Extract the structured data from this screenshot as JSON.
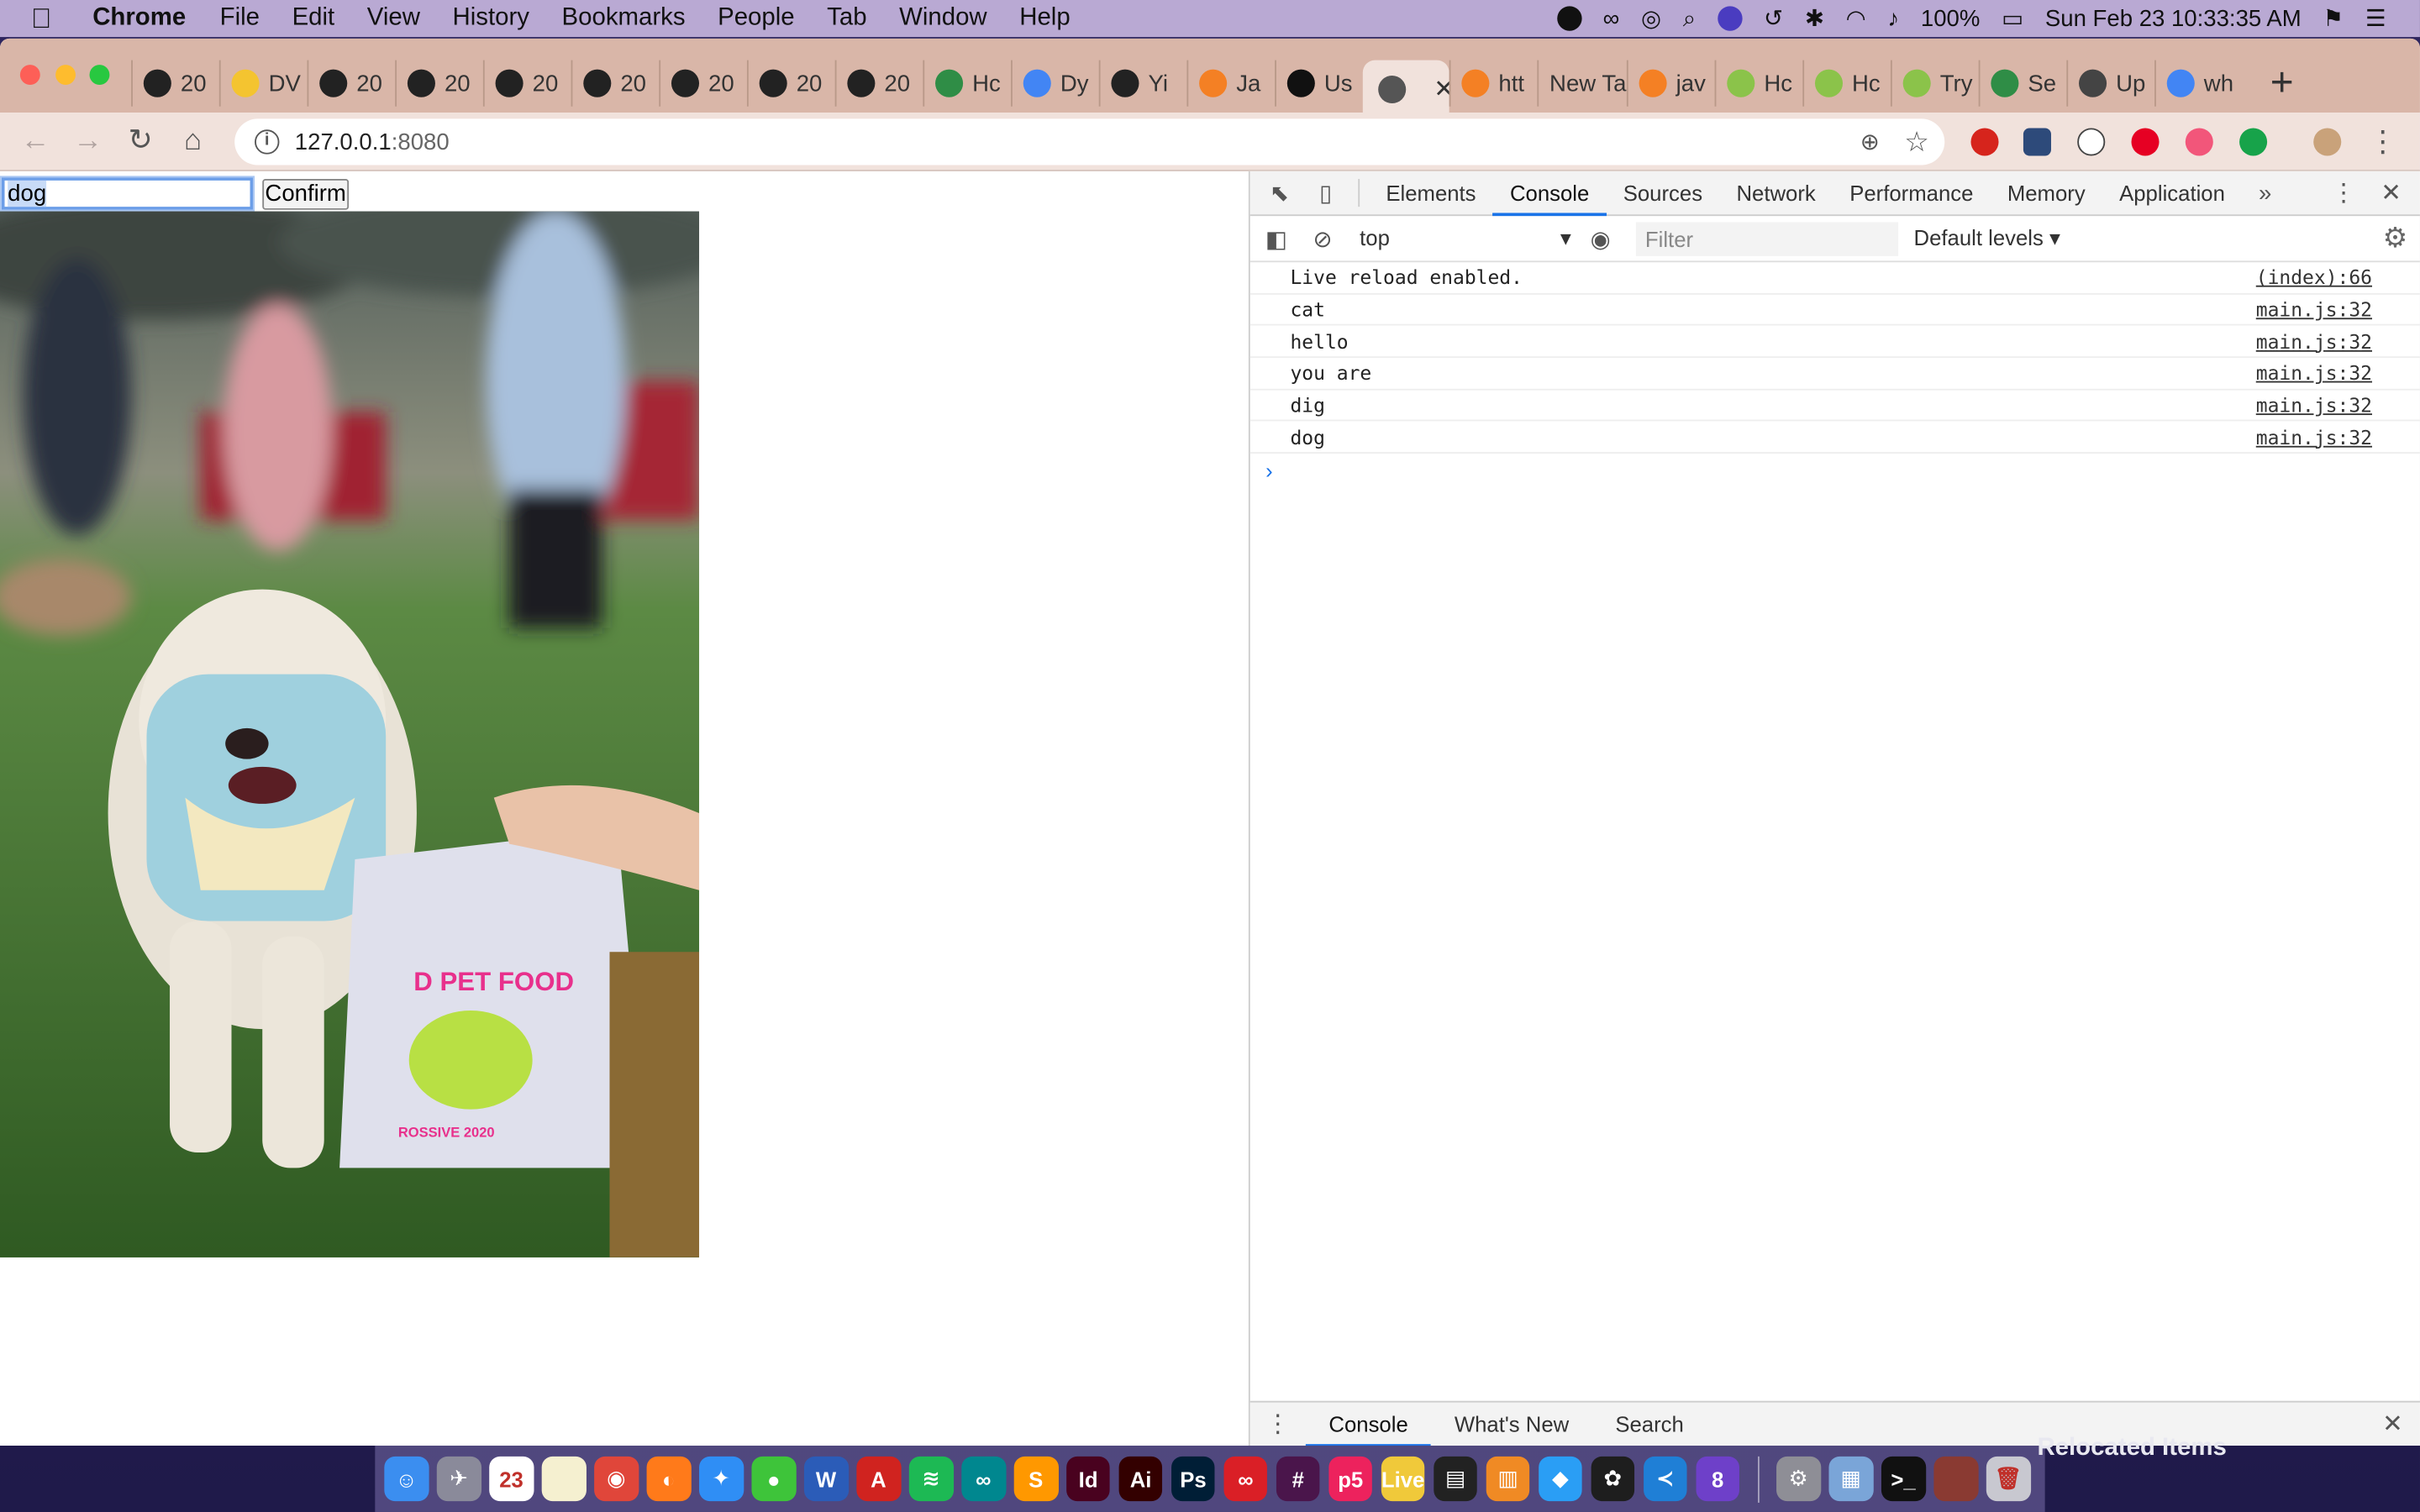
{
  "menubar": {
    "app_name": "Chrome",
    "items": [
      "File",
      "Edit",
      "View",
      "History",
      "Bookmarks",
      "People",
      "Tab",
      "Window",
      "Help"
    ],
    "battery": "100%",
    "datetime": "Sun Feb 23  10:33:35 AM"
  },
  "tabs": [
    {
      "title": "20",
      "icon": "github-icon"
    },
    {
      "title": "DV",
      "icon": "document-icon"
    },
    {
      "title": "20",
      "icon": "github-icon"
    },
    {
      "title": "20",
      "icon": "github-icon"
    },
    {
      "title": "20",
      "icon": "github-icon"
    },
    {
      "title": "20",
      "icon": "github-icon"
    },
    {
      "title": "20",
      "icon": "github-icon"
    },
    {
      "title": "20",
      "icon": "github-icon"
    },
    {
      "title": "20",
      "icon": "github-icon"
    },
    {
      "title": "Hc",
      "icon": "gfg-icon"
    },
    {
      "title": "Dy",
      "icon": "docs-icon"
    },
    {
      "title": "Yi",
      "icon": "github-icon"
    },
    {
      "title": "Ja",
      "icon": "stackoverflow-icon"
    },
    {
      "title": "Us",
      "icon": "bulb-icon"
    },
    {
      "title": "",
      "icon": "globe-icon",
      "active": true
    },
    {
      "title": "htt",
      "icon": "stackoverflow-icon"
    },
    {
      "title": "New Ta",
      "icon": ""
    },
    {
      "title": "jav",
      "icon": "stackoverflow-icon"
    },
    {
      "title": "Hc",
      "icon": "w3schools-icon"
    },
    {
      "title": "Hc",
      "icon": "w3schools-icon"
    },
    {
      "title": "Try",
      "icon": "w3schools-icon"
    },
    {
      "title": "Se",
      "icon": "gfg-icon"
    },
    {
      "title": "Up",
      "icon": "anchor-icon"
    },
    {
      "title": "wh",
      "icon": "google-icon"
    }
  ],
  "address": {
    "host": "127.0.0.1",
    "port": ":8080"
  },
  "page": {
    "input_value": "dog",
    "confirm_label": "Confirm",
    "photo_bag_text": "D PET FOOD",
    "photo_bag_year": "ROSSIVE 2020"
  },
  "devtools": {
    "tabs": [
      "Elements",
      "Console",
      "Sources",
      "Network",
      "Performance",
      "Memory",
      "Application"
    ],
    "active_tab": "Console",
    "context": "top",
    "filter_placeholder": "Filter",
    "levels": "Default levels",
    "console": [
      {
        "text": "Live reload enabled.",
        "source": "(index):66"
      },
      {
        "text": "cat",
        "source": "main.js:32"
      },
      {
        "text": "hello",
        "source": "main.js:32"
      },
      {
        "text": "you are",
        "source": "main.js:32"
      },
      {
        "text": "dig",
        "source": "main.js:32"
      },
      {
        "text": "dog",
        "source": "main.js:32"
      }
    ],
    "drawer_tabs": [
      "Console",
      "What's New",
      "Search"
    ]
  },
  "dock": {
    "apps": [
      {
        "name": "finder-icon",
        "color": "#3b8ef0",
        "glyph": "☺"
      },
      {
        "name": "launchpad-icon",
        "color": "#8a8a9a",
        "glyph": "✈"
      },
      {
        "name": "calendar-icon",
        "color": "#ffffff",
        "glyph": "23"
      },
      {
        "name": "notes-icon",
        "color": "#f5f0d0",
        "glyph": ""
      },
      {
        "name": "chrome-icon",
        "color": "#e0463a",
        "glyph": "◉"
      },
      {
        "name": "firefox-icon",
        "color": "#ff7a1a",
        "glyph": "◐"
      },
      {
        "name": "safari-icon",
        "color": "#2f8ef5",
        "glyph": "✦"
      },
      {
        "name": "wechat-icon",
        "color": "#3ec43a",
        "glyph": "●"
      },
      {
        "name": "word-icon",
        "color": "#2b5cb8",
        "glyph": "W"
      },
      {
        "name": "acrobat-icon",
        "color": "#d0231f",
        "glyph": "A"
      },
      {
        "name": "spotify-icon",
        "color": "#1db954",
        "glyph": "≋"
      },
      {
        "name": "arduino-icon",
        "color": "#00878f",
        "glyph": "∞"
      },
      {
        "name": "sublime-icon",
        "color": "#ff9800",
        "glyph": "S"
      },
      {
        "name": "indesign-icon",
        "color": "#49021f",
        "glyph": "Id"
      },
      {
        "name": "illustrator-icon",
        "color": "#330000",
        "glyph": "Ai"
      },
      {
        "name": "photoshop-icon",
        "color": "#001e36",
        "glyph": "Ps"
      },
      {
        "name": "creative-cloud-icon",
        "color": "#da1f26",
        "glyph": "∞"
      },
      {
        "name": "slack-icon",
        "color": "#4a154b",
        "glyph": "#"
      },
      {
        "name": "p5-icon",
        "color": "#ed225d",
        "glyph": "p5"
      },
      {
        "name": "live-icon",
        "color": "#f0c93a",
        "glyph": "Live"
      },
      {
        "name": "terminal-app-icon",
        "color": "#222222",
        "glyph": "▤"
      },
      {
        "name": "books-icon",
        "color": "#f08a24",
        "glyph": "▥"
      },
      {
        "name": "sketch-icon",
        "color": "#2a9ef5",
        "glyph": "◆"
      },
      {
        "name": "figma-icon",
        "color": "#1e1e1e",
        "glyph": "✿"
      },
      {
        "name": "vscode-icon",
        "color": "#1f7fd6",
        "glyph": "≺"
      },
      {
        "name": "github-desktop-icon",
        "color": "#6e40c9",
        "glyph": "8"
      },
      {
        "name": "system-preferences-icon",
        "color": "#8e8e96",
        "glyph": "⚙"
      },
      {
        "name": "preview-icon",
        "color": "#7aa5d8",
        "glyph": "▦"
      },
      {
        "name": "terminal-icon",
        "color": "#111111",
        "glyph": ">_"
      },
      {
        "name": "node-window-icon",
        "color": "#8a3a32",
        "glyph": ""
      },
      {
        "name": "trash-icon",
        "color": "#c8c8d0",
        "glyph": "🗑"
      }
    ],
    "relocated_label": "Relocated Items"
  }
}
